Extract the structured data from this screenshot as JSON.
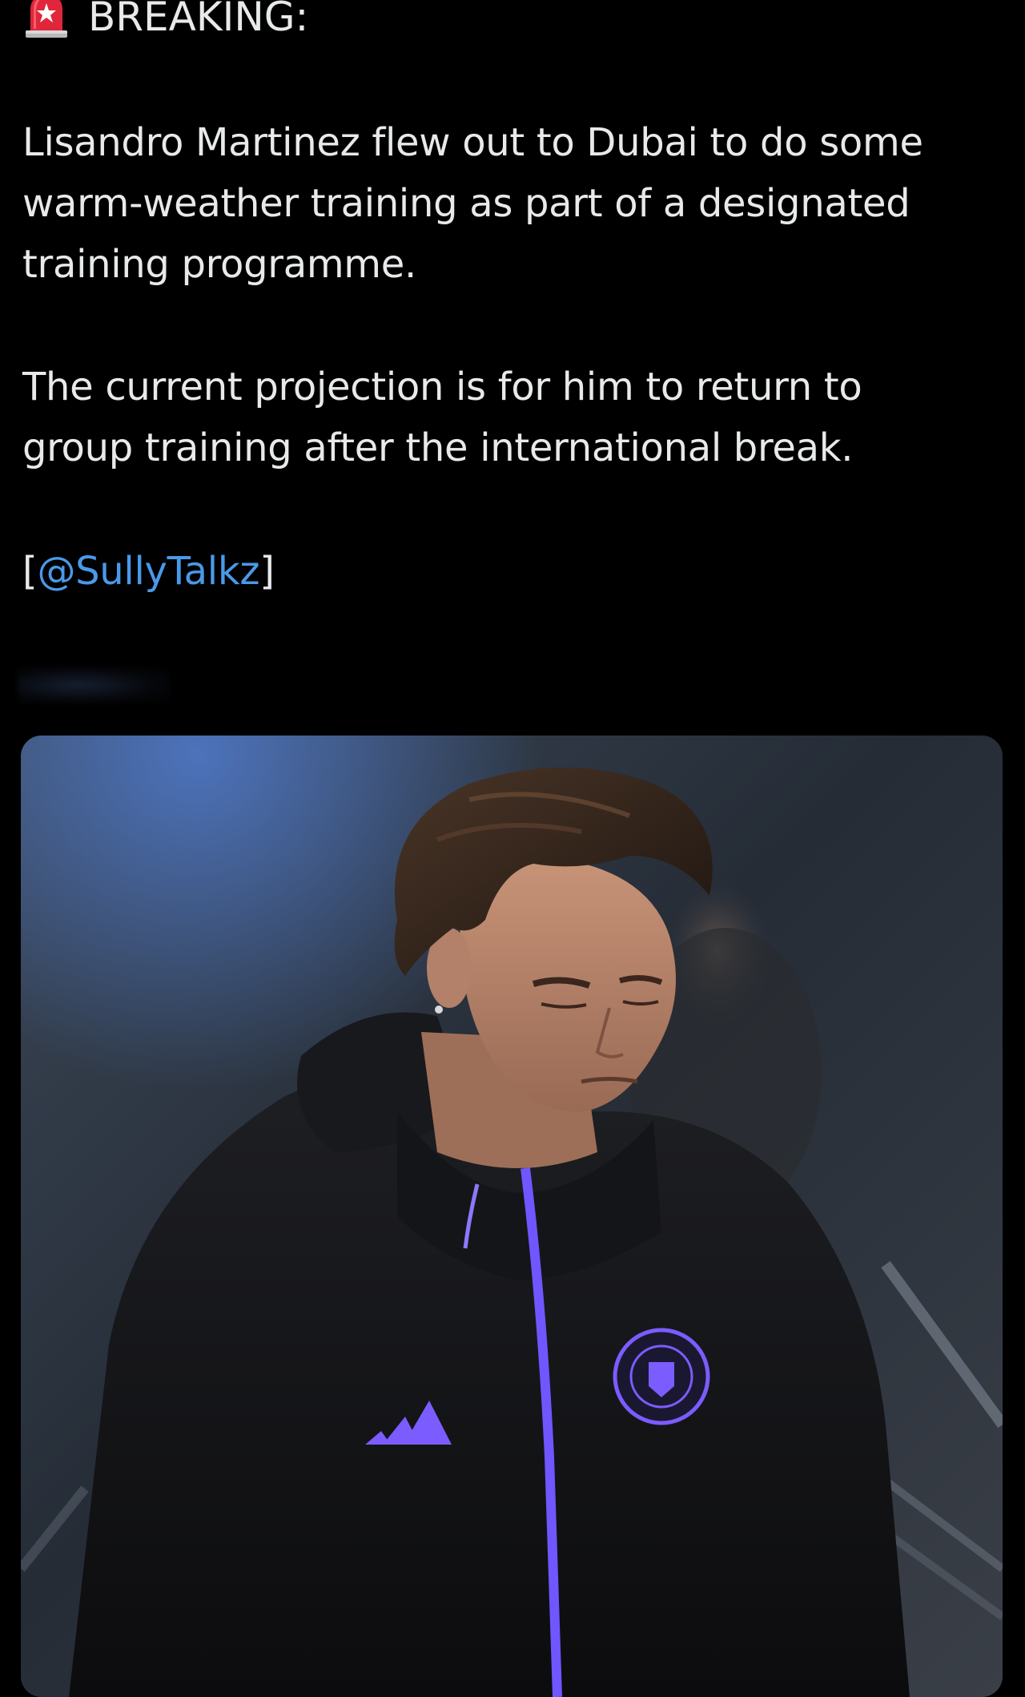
{
  "post": {
    "headline": "BREAKING:",
    "headline_icon": "siren-emoji-icon",
    "paragraph_1": "Lisandro Martinez flew out to Dubai to do some warm-weather training as part of a designated training programme.",
    "paragraph_2": "The current projection is for him to return to group training after the international break.",
    "source_open": "[",
    "source_mention": "@SullyTalkz",
    "source_close": "]"
  },
  "colors": {
    "background": "#000000",
    "text": "#e7e9ea",
    "link": "#4a99e9",
    "jacket_accent": "#7b5cff"
  },
  "media": {
    "description_icon": "photo-player-icon"
  }
}
